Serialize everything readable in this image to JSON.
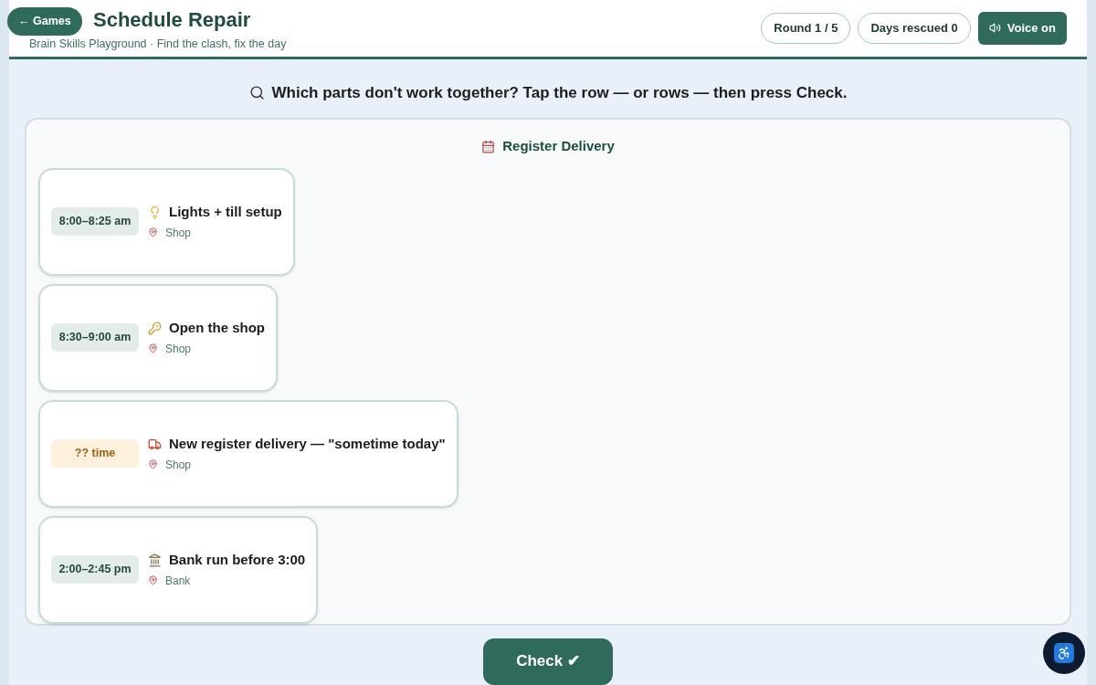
{
  "back_button": "← Games",
  "header": {
    "title": "Schedule Repair",
    "subtitle": "Brain Skills Playground · Find the clash, fix the day"
  },
  "stats": [
    {
      "label": "Round 1 / 5"
    },
    {
      "label": "Days rescued 0"
    }
  ],
  "voice_button": {
    "label": "Voice on",
    "on": true
  },
  "instruction": "Which parts don't work together? Tap the row — or rows — then press Check.",
  "schedule": {
    "title": "Register Delivery",
    "rows": [
      {
        "time": "8:00–8:25 am",
        "kind": "fixed",
        "title": "Lights + till setup",
        "place": "Shop",
        "selected": false
      },
      {
        "time": "8:30–9:00 am",
        "kind": "fixed",
        "title": "Open the shop",
        "place": "Shop",
        "selected": false
      },
      {
        "time": "?? time",
        "kind": "unknown",
        "title": "New register delivery — \"sometime today\"",
        "place": "Shop",
        "selected": false
      },
      {
        "time": "2:00–2:45 pm",
        "kind": "fixed",
        "title": "Bank run before 3:00",
        "place": "Bank",
        "selected": false
      }
    ]
  },
  "check_button": "Check ✔"
}
